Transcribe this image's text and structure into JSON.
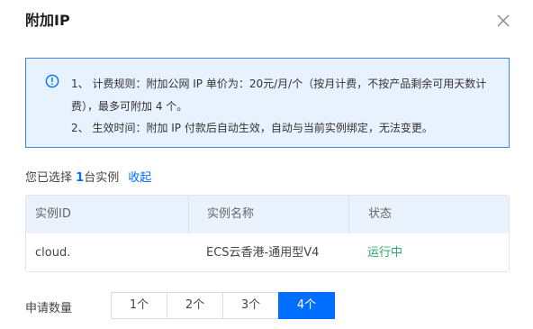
{
  "dialog": {
    "title": "附加IP"
  },
  "notice": {
    "line1": "1、 计费规则：附加公网 IP 单价为：20元/月/个（按月计费，不按产品剩余可用天数计",
    "line2": "费），最多可附加 4 个。",
    "line3": "2、 生效时间：附加 IP 付款后自动生效，自动与当前实例绑定，无法变更。"
  },
  "selection": {
    "prefix": "您已选择 ",
    "count": "1",
    "suffix": "台实例",
    "collapse_label": "收起"
  },
  "table": {
    "headers": [
      "实例ID",
      "实例名称",
      "状态"
    ],
    "rows": [
      {
        "id": "cloud.",
        "name": "ECS云香港-通用型V4",
        "status": "运行中"
      }
    ]
  },
  "quantity": {
    "label": "申请数量",
    "options": [
      "1个",
      "2个",
      "3个",
      "4个"
    ],
    "selected": "4个"
  },
  "colors": {
    "accent": "#006eff",
    "status_running": "#29a86a",
    "notice_border": "#3f84e6",
    "notice_bg": "#e8f2ff"
  },
  "icons": {
    "info": "info-icon",
    "close": "close-icon"
  }
}
